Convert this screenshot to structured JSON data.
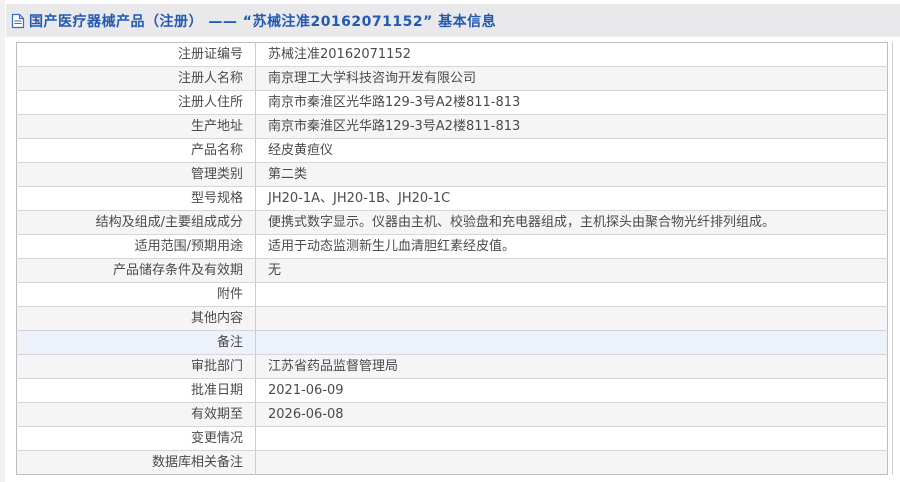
{
  "header": {
    "icon": "document-icon",
    "title": "国产医疗器械产品（注册） —— “苏械注准20162071152” 基本信息"
  },
  "table": {
    "highlighted_row_index": 12,
    "rows": [
      {
        "label": "注册证编号",
        "value": "苏械注准20162071152"
      },
      {
        "label": "注册人名称",
        "value": "南京理工大学科技咨询开发有限公司"
      },
      {
        "label": "注册人住所",
        "value": "南京市秦淮区光华路129-3号A2楼811-813"
      },
      {
        "label": "生产地址",
        "value": "南京市秦淮区光华路129-3号A2楼811-813"
      },
      {
        "label": "产品名称",
        "value": "经皮黄疸仪"
      },
      {
        "label": "管理类别",
        "value": "第二类"
      },
      {
        "label": "型号规格",
        "value": "JH20-1A、JH20-1B、JH20-1C"
      },
      {
        "label": "结构及组成/主要组成成分",
        "value": "便携式数字显示。仪器由主机、校验盘和充电器组成，主机探头由聚合物光纤排列组成。"
      },
      {
        "label": "适用范围/预期用途",
        "value": "适用于动态监测新生儿血清胆红素经皮值。"
      },
      {
        "label": "产品储存条件及有效期",
        "value": "无"
      },
      {
        "label": "附件",
        "value": ""
      },
      {
        "label": "其他内容",
        "value": ""
      },
      {
        "label": "备注",
        "value": ""
      },
      {
        "label": "审批部门",
        "value": "江苏省药品监督管理局"
      },
      {
        "label": "批准日期",
        "value": "2021-06-09"
      },
      {
        "label": "有效期至",
        "value": "2026-06-08"
      },
      {
        "label": "变更情况",
        "value": ""
      },
      {
        "label": "数据库相关备注",
        "value": ""
      }
    ]
  },
  "colors": {
    "title_blue": "#2359b0",
    "header_bar_bg": "#e9e9eb",
    "row_alt_bg": "#f5f5f7",
    "row_highlight_bg": "#edf1f9",
    "table_border": "#cccccc"
  }
}
